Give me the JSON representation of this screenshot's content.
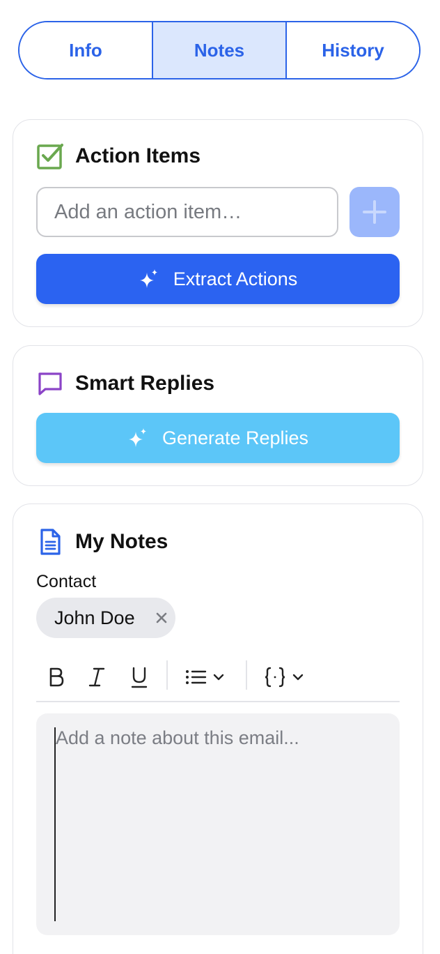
{
  "tabs": [
    {
      "label": "Info",
      "active": false
    },
    {
      "label": "Notes",
      "active": true
    },
    {
      "label": "History",
      "active": false
    }
  ],
  "action_items": {
    "title": "Action Items",
    "icon": "checkbox-icon",
    "input_placeholder": "Add an action item…",
    "add_icon": "plus-icon",
    "extract_label": "Extract Actions",
    "extract_icon": "sparkle-icon"
  },
  "smart_replies": {
    "title": "Smart Replies",
    "icon": "chat-bubble-icon",
    "generate_label": "Generate Replies",
    "generate_icon": "sparkle-icon"
  },
  "my_notes": {
    "title": "My Notes",
    "icon": "document-icon",
    "contact_label": "Contact",
    "contact_chip": "John Doe",
    "toolbar": [
      "bold-icon",
      "italic-icon",
      "underline-icon",
      "list-icon",
      "code-braces-icon"
    ],
    "note_placeholder": "Add a note about this email..."
  },
  "colors": {
    "accent": "#2b63e8",
    "tab_active_bg": "#dbe7fd",
    "extract_btn": "#2b63f1",
    "generate_btn": "#5cc6f8",
    "add_btn": "#9bb7fb",
    "check_icon": "#6aa84f",
    "chat_icon": "#8b44c7"
  }
}
